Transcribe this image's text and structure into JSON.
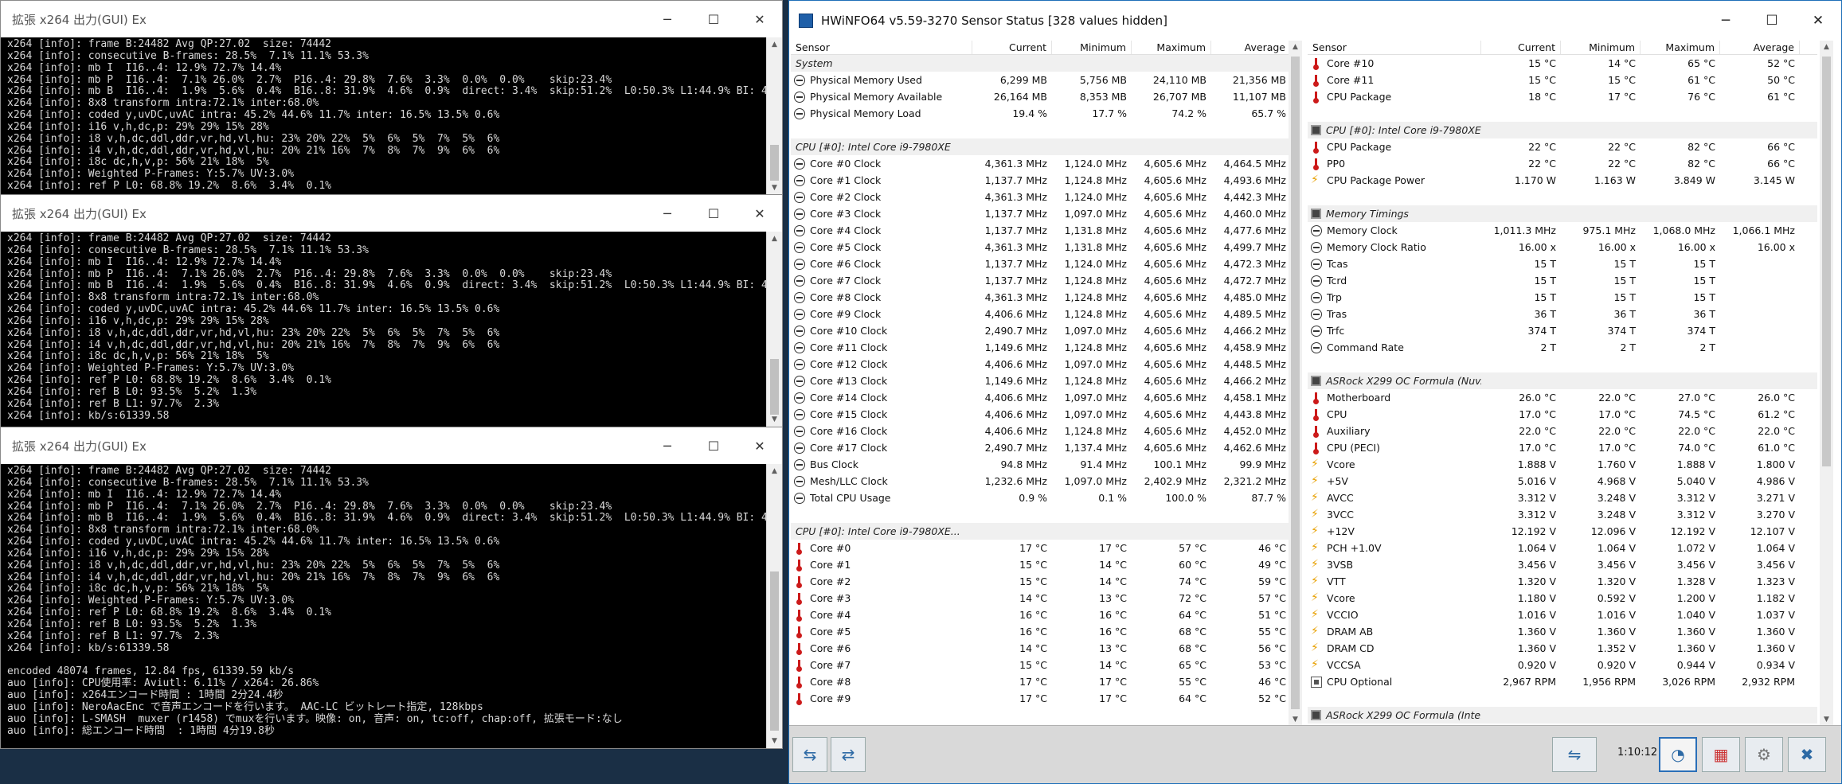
{
  "console_windows": [
    {
      "title": "拡張 x264 出力(GUI) Ex",
      "lines": [
        "x264 [info]: frame B:24482 Avg QP:27.02  size: 74442",
        "x264 [info]: consecutive B-frames: 28.5%  7.1% 11.1% 53.3%",
        "x264 [info]: mb I  I16..4: 12.9% 72.7% 14.4%",
        "x264 [info]: mb P  I16..4:  7.1% 26.0%  2.7%  P16..4: 29.8%  7.6%  3.3%  0.0%  0.0%    skip:23.4%",
        "x264 [info]: mb B  I16..4:  1.9%  5.6%  0.4%  B16..8: 31.9%  4.6%  0.9%  direct: 3.4%  skip:51.2%  L0:50.3% L1:44.9% BI: 4.9%",
        "x264 [info]: 8x8 transform intra:72.1% inter:68.0%",
        "x264 [info]: coded y,uvDC,uvAC intra: 45.2% 44.6% 11.7% inter: 16.5% 13.5% 0.6%",
        "x264 [info]: i16 v,h,dc,p: 29% 29% 15% 28%",
        "x264 [info]: i8 v,h,dc,ddl,ddr,vr,hd,vl,hu: 23% 20% 22%  5%  6%  5%  7%  5%  6%",
        "x264 [info]: i4 v,h,dc,ddl,ddr,vr,hd,vl,hu: 20% 21% 16%  7%  8%  7%  9%  6%  6%",
        "x264 [info]: i8c dc,h,v,p: 56% 21% 18%  5%",
        "x264 [info]: Weighted P-Frames: Y:5.7% UV:3.0%",
        "x264 [info]: ref P L0: 68.8% 19.2%  8.6%  3.4%  0.1%"
      ]
    },
    {
      "title": "拡張 x264 出力(GUI) Ex",
      "lines": [
        "x264 [info]: frame B:24482 Avg QP:27.02  size: 74442",
        "x264 [info]: consecutive B-frames: 28.5%  7.1% 11.1% 53.3%",
        "x264 [info]: mb I  I16..4: 12.9% 72.7% 14.4%",
        "x264 [info]: mb P  I16..4:  7.1% 26.0%  2.7%  P16..4: 29.8%  7.6%  3.3%  0.0%  0.0%    skip:23.4%",
        "x264 [info]: mb B  I16..4:  1.9%  5.6%  0.4%  B16..8: 31.9%  4.6%  0.9%  direct: 3.4%  skip:51.2%  L0:50.3% L1:44.9% BI: 4.9%",
        "x264 [info]: 8x8 transform intra:72.1% inter:68.0%",
        "x264 [info]: coded y,uvDC,uvAC intra: 45.2% 44.6% 11.7% inter: 16.5% 13.5% 0.6%",
        "x264 [info]: i16 v,h,dc,p: 29% 29% 15% 28%",
        "x264 [info]: i8 v,h,dc,ddl,ddr,vr,hd,vl,hu: 23% 20% 22%  5%  6%  5%  7%  5%  6%",
        "x264 [info]: i4 v,h,dc,ddl,ddr,vr,hd,vl,hu: 20% 21% 16%  7%  8%  7%  9%  6%  6%",
        "x264 [info]: i8c dc,h,v,p: 56% 21% 18%  5%",
        "x264 [info]: Weighted P-Frames: Y:5.7% UV:3.0%",
        "x264 [info]: ref P L0: 68.8% 19.2%  8.6%  3.4%  0.1%",
        "x264 [info]: ref B L0: 93.5%  5.2%  1.3%",
        "x264 [info]: ref B L1: 97.7%  2.3%",
        "x264 [info]: kb/s:61339.58"
      ]
    },
    {
      "title": "拡張 x264 出力(GUI) Ex",
      "lines": [
        "x264 [info]: frame B:24482 Avg QP:27.02  size: 74442",
        "x264 [info]: consecutive B-frames: 28.5%  7.1% 11.1% 53.3%",
        "x264 [info]: mb I  I16..4: 12.9% 72.7% 14.4%",
        "x264 [info]: mb P  I16..4:  7.1% 26.0%  2.7%  P16..4: 29.8%  7.6%  3.3%  0.0%  0.0%    skip:23.4%",
        "x264 [info]: mb B  I16..4:  1.9%  5.6%  0.4%  B16..8: 31.9%  4.6%  0.9%  direct: 3.4%  skip:51.2%  L0:50.3% L1:44.9% BI: 4.9%",
        "x264 [info]: 8x8 transform intra:72.1% inter:68.0%",
        "x264 [info]: coded y,uvDC,uvAC intra: 45.2% 44.6% 11.7% inter: 16.5% 13.5% 0.6%",
        "x264 [info]: i16 v,h,dc,p: 29% 29% 15% 28%",
        "x264 [info]: i8 v,h,dc,ddl,ddr,vr,hd,vl,hu: 23% 20% 22%  5%  6%  5%  7%  5%  6%",
        "x264 [info]: i4 v,h,dc,ddl,ddr,vr,hd,vl,hu: 20% 21% 16%  7%  8%  7%  9%  6%  6%",
        "x264 [info]: i8c dc,h,v,p: 56% 21% 18%  5%",
        "x264 [info]: Weighted P-Frames: Y:5.7% UV:3.0%",
        "x264 [info]: ref P L0: 68.8% 19.2%  8.6%  3.4%  0.1%",
        "x264 [info]: ref B L0: 93.5%  5.2%  1.3%",
        "x264 [info]: ref B L1: 97.7%  2.3%",
        "x264 [info]: kb/s:61339.58",
        "",
        "encoded 48074 frames, 12.84 fps, 61339.59 kb/s",
        "auo [info]: CPU使用率: Aviutl: 6.11% / x264: 26.86%",
        "auo [info]: x264エンコード時間 : 1時間 2分24.4秒",
        "auo [info]: NeroAacEnc で音声エンコードを行います。 AAC-LC ビットレート指定, 128kbps",
        "auo [info]: L-SMASH  muxer (r1458) でmuxを行います。映像: on, 音声: on, tc:off, chap:off, 拡張モード:なし",
        "auo [info]: 総エンコード時間  : 1時間 4分19.8秒"
      ]
    }
  ],
  "hwinfo": {
    "title": "HWiNFO64 v5.59-3270 Sensor Status [328 values hidden]",
    "columns": [
      "Sensor",
      "Current",
      "Minimum",
      "Maximum",
      "Average"
    ],
    "left_rows": [
      {
        "k": "grp",
        "icon": "none",
        "name": "System"
      },
      {
        "k": "row",
        "icon": "clock",
        "name": "Physical Memory Used",
        "v": [
          "6,299 MB",
          "5,756 MB",
          "24,110 MB",
          "21,356 MB"
        ]
      },
      {
        "k": "row",
        "icon": "clock",
        "name": "Physical Memory Available",
        "v": [
          "26,164 MB",
          "8,353 MB",
          "26,707 MB",
          "11,107 MB"
        ]
      },
      {
        "k": "row",
        "icon": "clock",
        "name": "Physical Memory Load",
        "v": [
          "19.4 %",
          "17.7 %",
          "74.2 %",
          "65.7 %"
        ]
      },
      {
        "k": "gap"
      },
      {
        "k": "grp",
        "icon": "none",
        "name": "CPU [#0]: Intel Core i9-7980XE"
      },
      {
        "k": "row",
        "icon": "clock",
        "name": "Core #0 Clock",
        "v": [
          "4,361.3 MHz",
          "1,124.0 MHz",
          "4,605.6 MHz",
          "4,464.5 MHz"
        ]
      },
      {
        "k": "row",
        "icon": "clock",
        "name": "Core #1 Clock",
        "v": [
          "1,137.7 MHz",
          "1,124.8 MHz",
          "4,605.6 MHz",
          "4,493.6 MHz"
        ]
      },
      {
        "k": "row",
        "icon": "clock",
        "name": "Core #2 Clock",
        "v": [
          "4,361.3 MHz",
          "1,124.0 MHz",
          "4,605.6 MHz",
          "4,442.3 MHz"
        ]
      },
      {
        "k": "row",
        "icon": "clock",
        "name": "Core #3 Clock",
        "v": [
          "1,137.7 MHz",
          "1,097.0 MHz",
          "4,605.6 MHz",
          "4,460.0 MHz"
        ]
      },
      {
        "k": "row",
        "icon": "clock",
        "name": "Core #4 Clock",
        "v": [
          "1,137.7 MHz",
          "1,131.8 MHz",
          "4,605.6 MHz",
          "4,477.6 MHz"
        ]
      },
      {
        "k": "row",
        "icon": "clock",
        "name": "Core #5 Clock",
        "v": [
          "4,361.3 MHz",
          "1,131.8 MHz",
          "4,605.6 MHz",
          "4,499.7 MHz"
        ]
      },
      {
        "k": "row",
        "icon": "clock",
        "name": "Core #6 Clock",
        "v": [
          "1,137.7 MHz",
          "1,124.0 MHz",
          "4,605.6 MHz",
          "4,472.3 MHz"
        ]
      },
      {
        "k": "row",
        "icon": "clock",
        "name": "Core #7 Clock",
        "v": [
          "1,137.7 MHz",
          "1,124.8 MHz",
          "4,605.6 MHz",
          "4,472.7 MHz"
        ]
      },
      {
        "k": "row",
        "icon": "clock",
        "name": "Core #8 Clock",
        "v": [
          "4,361.3 MHz",
          "1,124.8 MHz",
          "4,605.6 MHz",
          "4,485.0 MHz"
        ]
      },
      {
        "k": "row",
        "icon": "clock",
        "name": "Core #9 Clock",
        "v": [
          "4,406.6 MHz",
          "1,124.8 MHz",
          "4,605.6 MHz",
          "4,489.5 MHz"
        ]
      },
      {
        "k": "row",
        "icon": "clock",
        "name": "Core #10 Clock",
        "v": [
          "2,490.7 MHz",
          "1,097.0 MHz",
          "4,605.6 MHz",
          "4,466.2 MHz"
        ]
      },
      {
        "k": "row",
        "icon": "clock",
        "name": "Core #11 Clock",
        "v": [
          "1,149.6 MHz",
          "1,124.8 MHz",
          "4,605.6 MHz",
          "4,458.9 MHz"
        ]
      },
      {
        "k": "row",
        "icon": "clock",
        "name": "Core #12 Clock",
        "v": [
          "4,406.6 MHz",
          "1,097.0 MHz",
          "4,605.6 MHz",
          "4,448.5 MHz"
        ]
      },
      {
        "k": "row",
        "icon": "clock",
        "name": "Core #13 Clock",
        "v": [
          "1,149.6 MHz",
          "1,124.8 MHz",
          "4,605.6 MHz",
          "4,466.2 MHz"
        ]
      },
      {
        "k": "row",
        "icon": "clock",
        "name": "Core #14 Clock",
        "v": [
          "4,406.6 MHz",
          "1,097.0 MHz",
          "4,605.6 MHz",
          "4,458.1 MHz"
        ]
      },
      {
        "k": "row",
        "icon": "clock",
        "name": "Core #15 Clock",
        "v": [
          "4,406.6 MHz",
          "1,097.0 MHz",
          "4,605.6 MHz",
          "4,443.8 MHz"
        ]
      },
      {
        "k": "row",
        "icon": "clock",
        "name": "Core #16 Clock",
        "v": [
          "4,406.6 MHz",
          "1,124.8 MHz",
          "4,605.6 MHz",
          "4,452.0 MHz"
        ]
      },
      {
        "k": "row",
        "icon": "clock",
        "name": "Core #17 Clock",
        "v": [
          "2,490.7 MHz",
          "1,137.4 MHz",
          "4,605.6 MHz",
          "4,462.6 MHz"
        ]
      },
      {
        "k": "row",
        "icon": "clock",
        "name": "Bus Clock",
        "v": [
          "94.8 MHz",
          "91.4 MHz",
          "100.1 MHz",
          "99.9 MHz"
        ]
      },
      {
        "k": "row",
        "icon": "clock",
        "name": "Mesh/LLC Clock",
        "v": [
          "1,232.6 MHz",
          "1,097.0 MHz",
          "2,402.9 MHz",
          "2,321.2 MHz"
        ]
      },
      {
        "k": "row",
        "icon": "clock",
        "name": "Total CPU Usage",
        "v": [
          "0.9 %",
          "0.1 %",
          "100.0 %",
          "87.7 %"
        ]
      },
      {
        "k": "gap"
      },
      {
        "k": "grp",
        "icon": "none",
        "name": "CPU [#0]: Intel Core i9-7980XE..."
      },
      {
        "k": "row",
        "icon": "temp",
        "name": "Core #0",
        "v": [
          "17 °C",
          "17 °C",
          "57 °C",
          "46 °C"
        ]
      },
      {
        "k": "row",
        "icon": "temp",
        "name": "Core #1",
        "v": [
          "15 °C",
          "14 °C",
          "60 °C",
          "49 °C"
        ]
      },
      {
        "k": "row",
        "icon": "temp",
        "name": "Core #2",
        "v": [
          "15 °C",
          "14 °C",
          "74 °C",
          "59 °C"
        ]
      },
      {
        "k": "row",
        "icon": "temp",
        "name": "Core #3",
        "v": [
          "14 °C",
          "13 °C",
          "72 °C",
          "57 °C"
        ]
      },
      {
        "k": "row",
        "icon": "temp",
        "name": "Core #4",
        "v": [
          "16 °C",
          "16 °C",
          "64 °C",
          "51 °C"
        ]
      },
      {
        "k": "row",
        "icon": "temp",
        "name": "Core #5",
        "v": [
          "16 °C",
          "16 °C",
          "68 °C",
          "55 °C"
        ]
      },
      {
        "k": "row",
        "icon": "temp",
        "name": "Core #6",
        "v": [
          "14 °C",
          "13 °C",
          "68 °C",
          "56 °C"
        ]
      },
      {
        "k": "row",
        "icon": "temp",
        "name": "Core #7",
        "v": [
          "15 °C",
          "14 °C",
          "65 °C",
          "53 °C"
        ]
      },
      {
        "k": "row",
        "icon": "temp",
        "name": "Core #8",
        "v": [
          "17 °C",
          "17 °C",
          "55 °C",
          "46 °C"
        ]
      },
      {
        "k": "row",
        "icon": "temp",
        "name": "Core #9",
        "v": [
          "17 °C",
          "17 °C",
          "64 °C",
          "52 °C"
        ]
      }
    ],
    "right_rows": [
      {
        "k": "row",
        "icon": "temp",
        "name": "Core #10",
        "v": [
          "15 °C",
          "14 °C",
          "65 °C",
          "52 °C"
        ]
      },
      {
        "k": "row",
        "icon": "temp",
        "name": "Core #11",
        "v": [
          "15 °C",
          "15 °C",
          "61 °C",
          "50 °C"
        ]
      },
      {
        "k": "row",
        "icon": "temp",
        "name": "CPU Package",
        "v": [
          "18 °C",
          "17 °C",
          "76 °C",
          "61 °C"
        ]
      },
      {
        "k": "gap"
      },
      {
        "k": "grp",
        "icon": "grpchip",
        "name": "CPU [#0]: Intel Core i9-7980XE"
      },
      {
        "k": "row",
        "icon": "temp",
        "name": "CPU Package",
        "v": [
          "22 °C",
          "22 °C",
          "82 °C",
          "66 °C"
        ]
      },
      {
        "k": "row",
        "icon": "temp",
        "name": "PP0",
        "v": [
          "22 °C",
          "22 °C",
          "82 °C",
          "66 °C"
        ]
      },
      {
        "k": "row",
        "icon": "volt",
        "name": "CPU Package Power",
        "v": [
          "1.170 W",
          "1.163 W",
          "3.849 W",
          "3.145 W"
        ]
      },
      {
        "k": "gap"
      },
      {
        "k": "grp",
        "icon": "grpchip",
        "name": "Memory Timings"
      },
      {
        "k": "row",
        "icon": "clock",
        "name": "Memory Clock",
        "v": [
          "1,011.3 MHz",
          "975.1 MHz",
          "1,068.0 MHz",
          "1,066.1 MHz"
        ]
      },
      {
        "k": "row",
        "icon": "clock",
        "name": "Memory Clock Ratio",
        "v": [
          "16.00 x",
          "16.00 x",
          "16.00 x",
          "16.00 x"
        ]
      },
      {
        "k": "row",
        "icon": "clock",
        "name": "Tcas",
        "v": [
          "15 T",
          "15 T",
          "15 T",
          ""
        ]
      },
      {
        "k": "row",
        "icon": "clock",
        "name": "Tcrd",
        "v": [
          "15 T",
          "15 T",
          "15 T",
          ""
        ]
      },
      {
        "k": "row",
        "icon": "clock",
        "name": "Trp",
        "v": [
          "15 T",
          "15 T",
          "15 T",
          ""
        ]
      },
      {
        "k": "row",
        "icon": "clock",
        "name": "Tras",
        "v": [
          "36 T",
          "36 T",
          "36 T",
          ""
        ]
      },
      {
        "k": "row",
        "icon": "clock",
        "name": "Trfc",
        "v": [
          "374 T",
          "374 T",
          "374 T",
          ""
        ]
      },
      {
        "k": "row",
        "icon": "clock",
        "name": "Command Rate",
        "v": [
          "2 T",
          "2 T",
          "2 T",
          ""
        ]
      },
      {
        "k": "gap"
      },
      {
        "k": "grp",
        "icon": "grpchip",
        "name": "ASRock X299 OC Formula (Nuv..."
      },
      {
        "k": "row",
        "icon": "temp",
        "name": "Motherboard",
        "v": [
          "26.0 °C",
          "22.0 °C",
          "27.0 °C",
          "26.0 °C"
        ]
      },
      {
        "k": "row",
        "icon": "temp",
        "name": "CPU",
        "v": [
          "17.0 °C",
          "17.0 °C",
          "74.5 °C",
          "61.2 °C"
        ]
      },
      {
        "k": "row",
        "icon": "temp",
        "name": "Auxiliary",
        "v": [
          "22.0 °C",
          "22.0 °C",
          "22.0 °C",
          "22.0 °C"
        ]
      },
      {
        "k": "row",
        "icon": "temp",
        "name": "CPU (PECI)",
        "v": [
          "17.0 °C",
          "17.0 °C",
          "74.0 °C",
          "61.0 °C"
        ]
      },
      {
        "k": "row",
        "icon": "volt",
        "name": "Vcore",
        "v": [
          "1.888 V",
          "1.760 V",
          "1.888 V",
          "1.800 V"
        ]
      },
      {
        "k": "row",
        "icon": "volt",
        "name": "+5V",
        "v": [
          "5.016 V",
          "4.968 V",
          "5.040 V",
          "4.986 V"
        ]
      },
      {
        "k": "row",
        "icon": "volt",
        "name": "AVCC",
        "v": [
          "3.312 V",
          "3.248 V",
          "3.312 V",
          "3.271 V"
        ]
      },
      {
        "k": "row",
        "icon": "volt",
        "name": "3VCC",
        "v": [
          "3.312 V",
          "3.248 V",
          "3.312 V",
          "3.270 V"
        ]
      },
      {
        "k": "row",
        "icon": "volt",
        "name": "+12V",
        "v": [
          "12.192 V",
          "12.096 V",
          "12.192 V",
          "12.107 V"
        ]
      },
      {
        "k": "row",
        "icon": "volt",
        "name": "PCH +1.0V",
        "v": [
          "1.064 V",
          "1.064 V",
          "1.072 V",
          "1.064 V"
        ]
      },
      {
        "k": "row",
        "icon": "volt",
        "name": "3VSB",
        "v": [
          "3.456 V",
          "3.456 V",
          "3.456 V",
          "3.456 V"
        ]
      },
      {
        "k": "row",
        "icon": "volt",
        "name": "VTT",
        "v": [
          "1.320 V",
          "1.320 V",
          "1.328 V",
          "1.323 V"
        ]
      },
      {
        "k": "row",
        "icon": "volt",
        "name": "Vcore",
        "v": [
          "1.180 V",
          "0.592 V",
          "1.200 V",
          "1.182 V"
        ]
      },
      {
        "k": "row",
        "icon": "volt",
        "name": "VCCIO",
        "v": [
          "1.016 V",
          "1.016 V",
          "1.040 V",
          "1.037 V"
        ]
      },
      {
        "k": "row",
        "icon": "volt",
        "name": "DRAM AB",
        "v": [
          "1.360 V",
          "1.360 V",
          "1.360 V",
          "1.360 V"
        ]
      },
      {
        "k": "row",
        "icon": "volt",
        "name": "DRAM CD",
        "v": [
          "1.360 V",
          "1.352 V",
          "1.360 V",
          "1.360 V"
        ]
      },
      {
        "k": "row",
        "icon": "volt",
        "name": "VCCSA",
        "v": [
          "0.920 V",
          "0.920 V",
          "0.944 V",
          "0.934 V"
        ]
      },
      {
        "k": "row",
        "icon": "fan",
        "name": "CPU Optional",
        "v": [
          "2,967 RPM",
          "1,956 RPM",
          "3,026 RPM",
          "2,932 RPM"
        ]
      },
      {
        "k": "gap"
      },
      {
        "k": "grp",
        "icon": "grpchip",
        "name": "ASRock X299 OC Formula (Inte..."
      }
    ],
    "elapsed_time": "1:10:12"
  }
}
